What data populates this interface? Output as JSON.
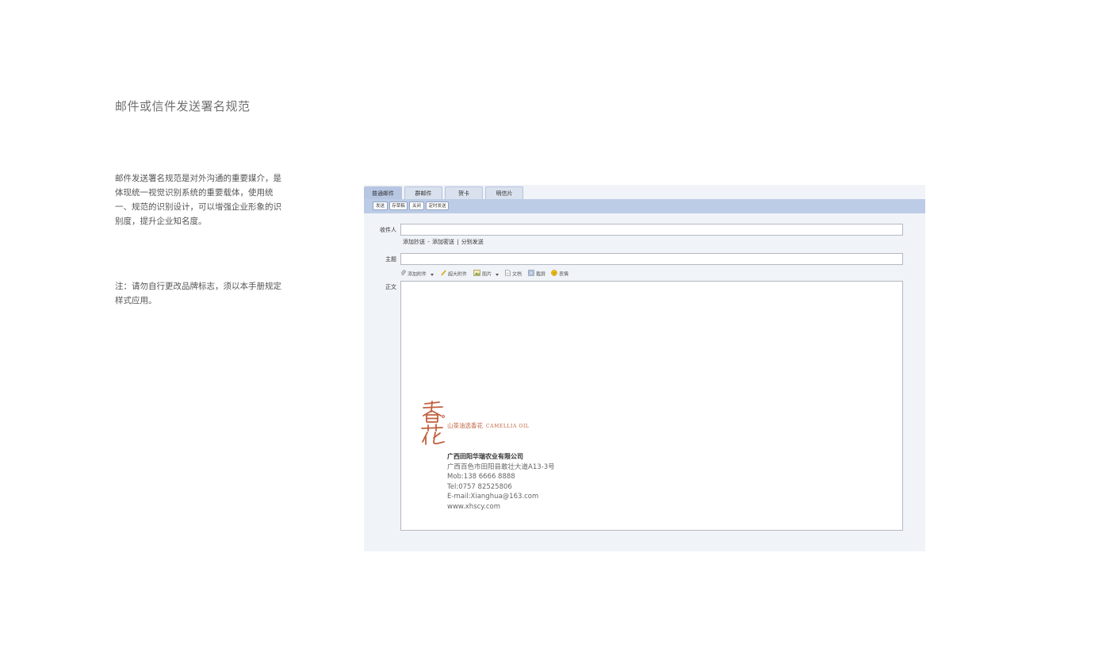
{
  "page": {
    "title": "邮件或信件发送署名规范",
    "description": "邮件发送署名规范是对外沟通的重要媒介，是体现统一视觉识别系统的重要载体，使用统一、规范的识别设计，可以增强企业形象的识别度，提升企业知名度。",
    "note": "注：请勿自行更改品牌标志，须以本手册规定样式应用。"
  },
  "mail": {
    "tabs": [
      {
        "label": "普通邮件",
        "active": true
      },
      {
        "label": "群邮件",
        "active": false
      },
      {
        "label": "贺卡",
        "active": false
      },
      {
        "label": "明信片",
        "active": false
      }
    ],
    "toolbar": [
      "发送",
      "存草稿",
      "关闭",
      "定时发送"
    ],
    "recipient_label": "收件人",
    "cc_links": {
      "add_cc": "添加抄送",
      "sep1": " - ",
      "add_bcc": "添加密送",
      "sep2": " | ",
      "separate_send": "分别发送"
    },
    "subject_label": "主题",
    "body_label": "正文",
    "attachments": [
      {
        "icon": "paperclip-icon",
        "label": "添加附件",
        "has_dropdown": true
      },
      {
        "icon": "large-attachment-icon",
        "label": "超大附件",
        "has_dropdown": false
      },
      {
        "icon": "picture-icon",
        "label": "图片",
        "has_dropdown": true
      },
      {
        "icon": "document-icon",
        "label": "文档",
        "has_dropdown": false
      },
      {
        "icon": "screenshot-icon",
        "label": "截屏",
        "has_dropdown": false
      },
      {
        "icon": "emoji-icon",
        "label": "表情",
        "has_dropdown": false
      }
    ],
    "signature": {
      "logo_text": "香花",
      "slogan_cn": "山茶油选香花",
      "slogan_en": "CAMELLIA OIL",
      "company": "广西田阳华瑞农业有限公司",
      "address": "广西百色市田阳县敢壮大道A13-3号",
      "mobile": "Mob:138 6666 8888",
      "tel": "Tel:0757 82525806",
      "email": "E-mail:Xianghua@163.com",
      "web": "www.xhscy.com"
    }
  },
  "colors": {
    "brand": "#c0603d",
    "toolbar_bg": "#bccce6",
    "panel_bg": "#f0f3f8"
  }
}
